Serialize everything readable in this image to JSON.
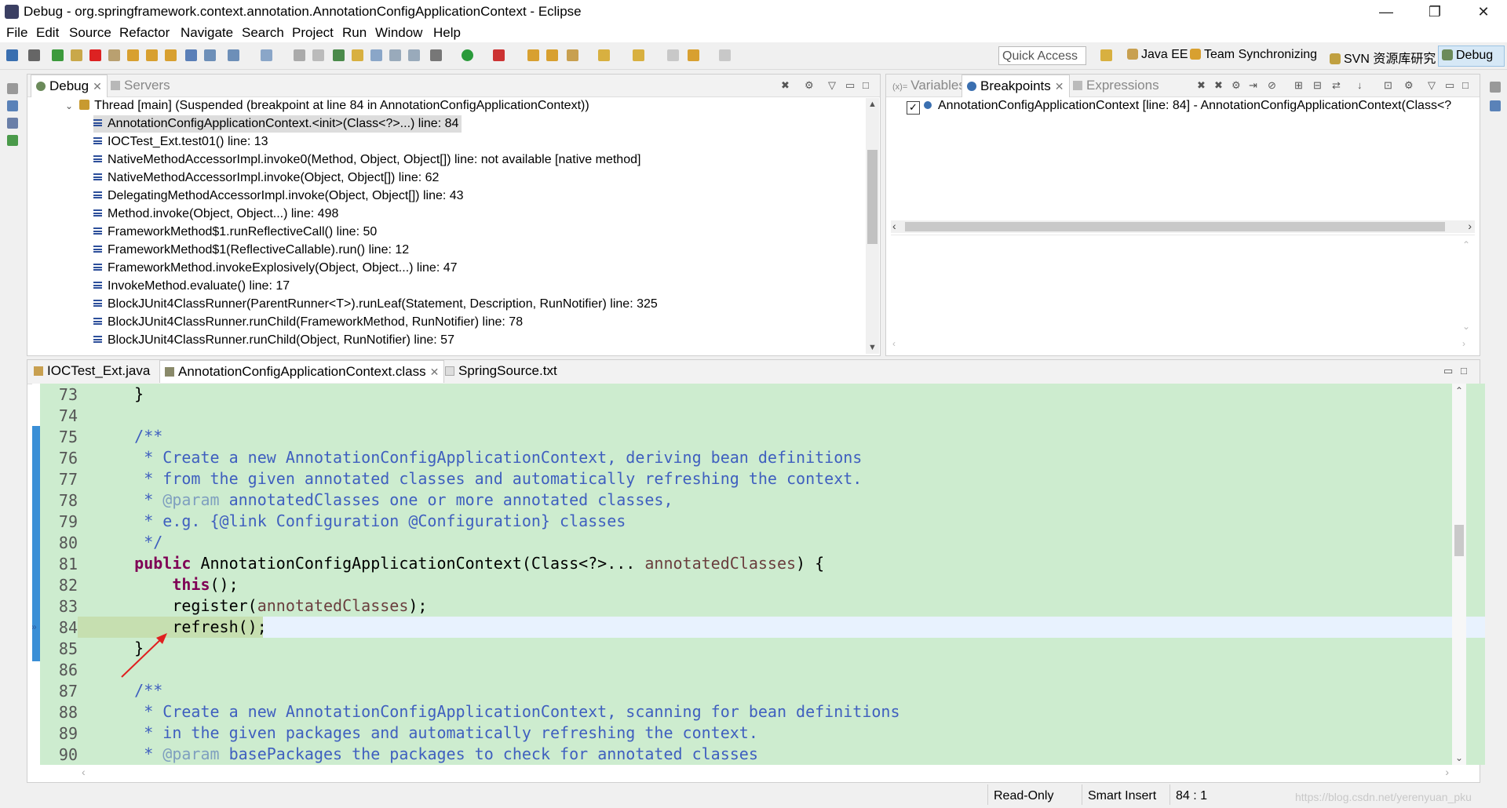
{
  "window": {
    "title": "Debug - org.springframework.context.annotation.AnnotationConfigApplicationContext - Eclipse",
    "minimize": "—",
    "restore": "❐",
    "close": "✕"
  },
  "menu": [
    "File",
    "Edit",
    "Source",
    "Refactor",
    "Navigate",
    "Search",
    "Project",
    "Run",
    "Window",
    "Help"
  ],
  "toolbar": {
    "quick_access_placeholder": "Quick Access",
    "perspectives": [
      "Java EE",
      "Team Synchronizing",
      "SVN 资源库研究",
      "Debug"
    ]
  },
  "debug_view": {
    "tabs": [
      "Debug",
      "Servers"
    ],
    "thread": "Thread [main] (Suspended (breakpoint at line 84 in AnnotationConfigApplicationContext))",
    "frames": [
      "AnnotationConfigApplicationContext.<init>(Class<?>...) line: 84",
      "IOCTest_Ext.test01() line: 13",
      "NativeMethodAccessorImpl.invoke0(Method, Object, Object[]) line: not available [native method]",
      "NativeMethodAccessorImpl.invoke(Object, Object[]) line: 62",
      "DelegatingMethodAccessorImpl.invoke(Object, Object[]) line: 43",
      "Method.invoke(Object, Object...) line: 498",
      "FrameworkMethod$1.runReflectiveCall() line: 50",
      "FrameworkMethod$1(ReflectiveCallable).run() line: 12",
      "FrameworkMethod.invokeExplosively(Object, Object...) line: 47",
      "InvokeMethod.evaluate() line: 17",
      "BlockJUnit4ClassRunner(ParentRunner<T>).runLeaf(Statement, Description, RunNotifier) line: 325",
      "BlockJUnit4ClassRunner.runChild(FrameworkMethod, RunNotifier) line: 78",
      "BlockJUnit4ClassRunner.runChild(Object, RunNotifier) line: 57"
    ]
  },
  "breakpoints_view": {
    "tabs": [
      "Variables",
      "Breakpoints",
      "Expressions"
    ],
    "entry": "AnnotationConfigApplicationContext [line: 84] - AnnotationConfigApplicationContext(Class<?"
  },
  "editor": {
    "tabs": [
      "IOCTest_Ext.java",
      "AnnotationConfigApplicationContext.class",
      "SpringSource.txt"
    ],
    "line_numbers": [
      "73",
      "74",
      "75",
      "76",
      "77",
      "78",
      "79",
      "80",
      "81",
      "82",
      "83",
      "84",
      "85",
      "86",
      "87",
      "88",
      "89",
      "90"
    ]
  },
  "status": {
    "mode": "Read-Only",
    "insert": "Smart Insert",
    "position": "84 : 1",
    "watermark": "https://blog.csdn.net/yerenyuan_pku"
  },
  "colors": {
    "editor_bg": "#cdeccf",
    "keyword": "#7f0055",
    "javadoc": "#3f5fbf",
    "arrow": "#e02020"
  }
}
